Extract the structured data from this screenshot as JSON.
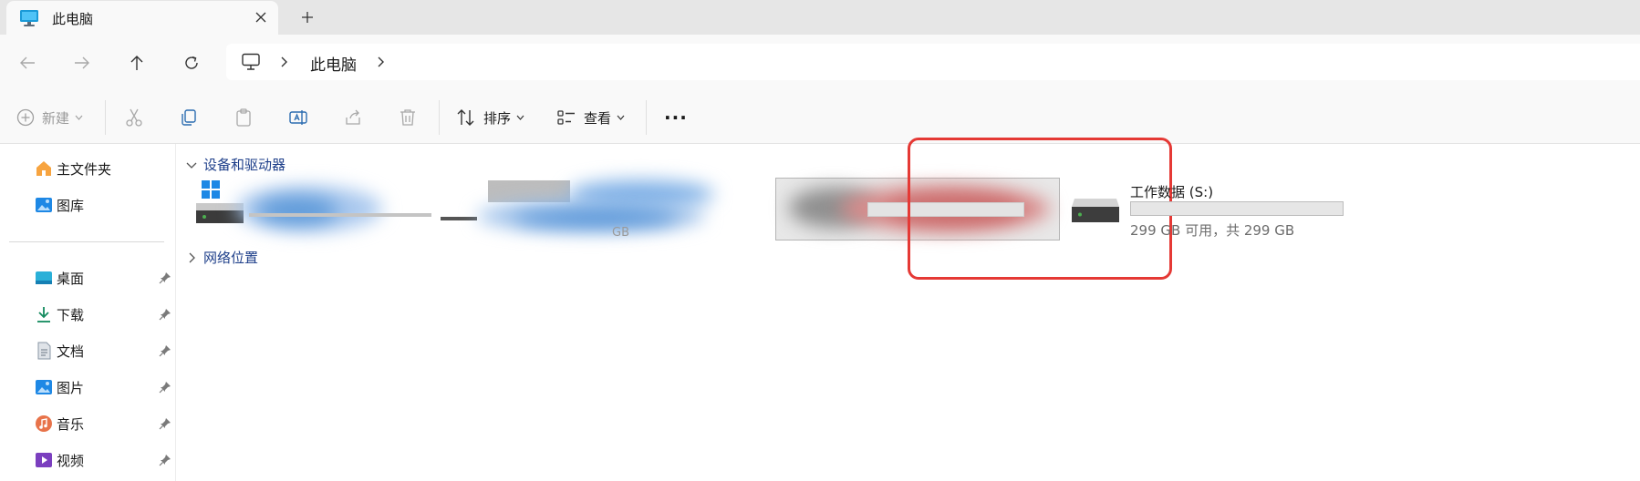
{
  "tab": {
    "title": "此电脑",
    "close_glyph": "✕",
    "new_tab_glyph": "+"
  },
  "nav": {
    "back_glyph": "←",
    "forward_glyph": "→",
    "up_glyph": "↑",
    "refresh_glyph": "↻",
    "breadcrumb": [
      "此电脑"
    ]
  },
  "commandbar": {
    "new_label": "新建",
    "sort_label": "排序",
    "view_label": "查看",
    "more_glyph": "···"
  },
  "sidebar": {
    "top_items": [
      {
        "label": "主文件夹",
        "icon": "home-icon"
      },
      {
        "label": "图库",
        "icon": "gallery-icon"
      }
    ],
    "pinned_items": [
      {
        "label": "桌面",
        "icon": "desktop-icon"
      },
      {
        "label": "下载",
        "icon": "download-icon"
      },
      {
        "label": "文档",
        "icon": "document-icon"
      },
      {
        "label": "图片",
        "icon": "pictures-icon"
      },
      {
        "label": "音乐",
        "icon": "music-icon"
      },
      {
        "label": "视频",
        "icon": "video-icon"
      }
    ]
  },
  "main": {
    "devices_section": "设备和驱动器",
    "network_section": "网络位置",
    "obscured_gb_label": "GB",
    "drive_s": {
      "name": "工作数据 (S:)",
      "free_text": "299 GB 可用，共 299 GB",
      "used_fraction": 0.0
    }
  },
  "colors": {
    "accent": "#0067c0",
    "highlight_border": "#e53935",
    "section_title": "#1e3f8a"
  }
}
